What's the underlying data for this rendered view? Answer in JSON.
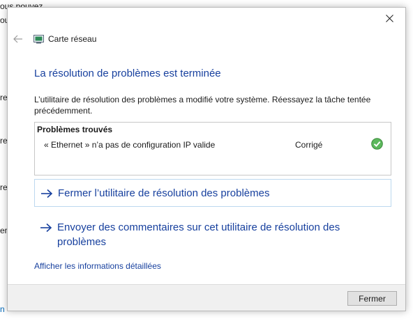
{
  "background": {
    "fragments": [
      "ous pouvez",
      "ou",
      "re",
      "re",
      "res",
      "er",
      "n"
    ]
  },
  "dialog": {
    "nav_title": "Carte réseau",
    "heading": "La résolution de problèmes est terminée",
    "description": "L’utilitaire de résolution des problèmes a modifié votre système. Réessayez la tâche tentée précédemment.",
    "problems": {
      "header": "Problèmes trouvés",
      "items": [
        {
          "name": "« Ethernet » n’a pas de configuration IP valide",
          "status": "Corrigé",
          "icon": "check-icon"
        }
      ]
    },
    "actions": [
      {
        "label": "Fermer l’utilitaire de résolution des problèmes",
        "icon": "arrow-right-icon"
      },
      {
        "label": "Envoyer des commentaires sur cet utilitaire de résolution des problèmes",
        "icon": "arrow-right-icon"
      }
    ],
    "details_link": "Afficher les informations détaillées",
    "footer_button": "Fermer"
  },
  "colors": {
    "heading": "#17409e",
    "check": "#4caf50",
    "link_border": "#bcd8ef"
  }
}
